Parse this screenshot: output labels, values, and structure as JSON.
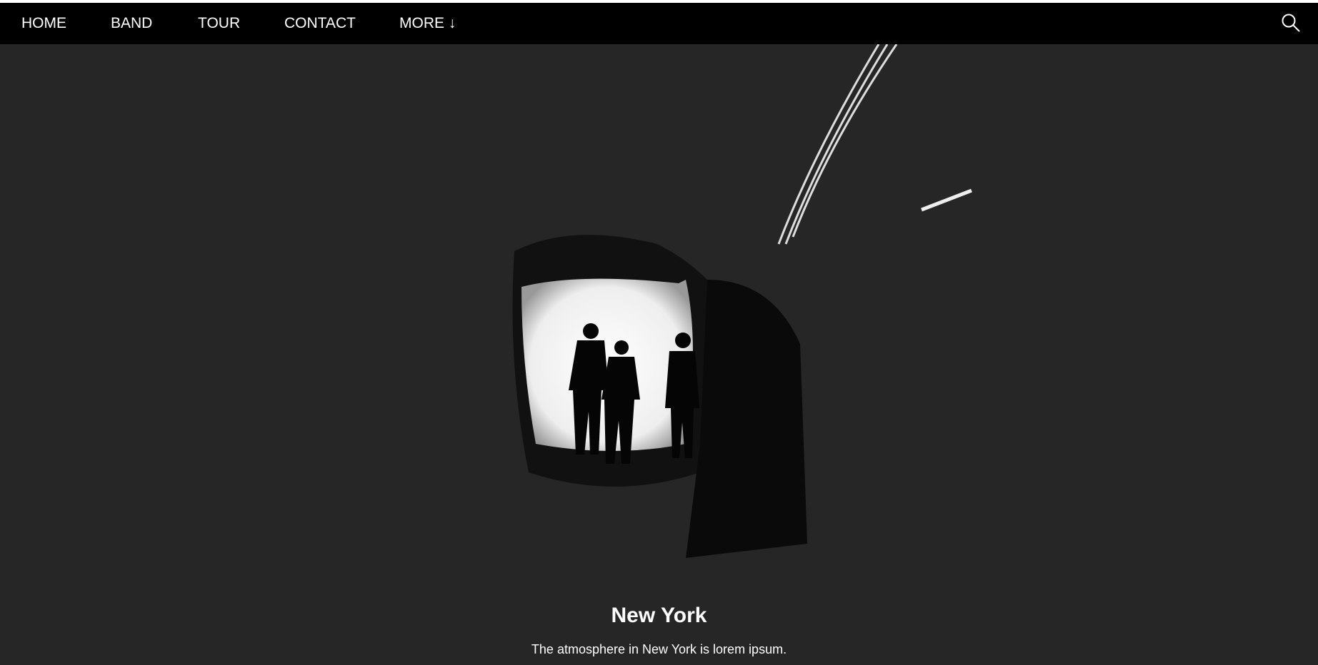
{
  "nav": {
    "items": [
      {
        "label": "HOME"
      },
      {
        "label": "BAND"
      },
      {
        "label": "TOUR"
      },
      {
        "label": "CONTACT"
      },
      {
        "label": "MORE ↓"
      }
    ],
    "search_icon": "search-icon"
  },
  "hero": {
    "title": "New York",
    "description": "The atmosphere in New York is lorem ipsum."
  },
  "colors": {
    "nav_bg": "#000000",
    "page_bg": "#262626",
    "text": "#ffffff"
  }
}
